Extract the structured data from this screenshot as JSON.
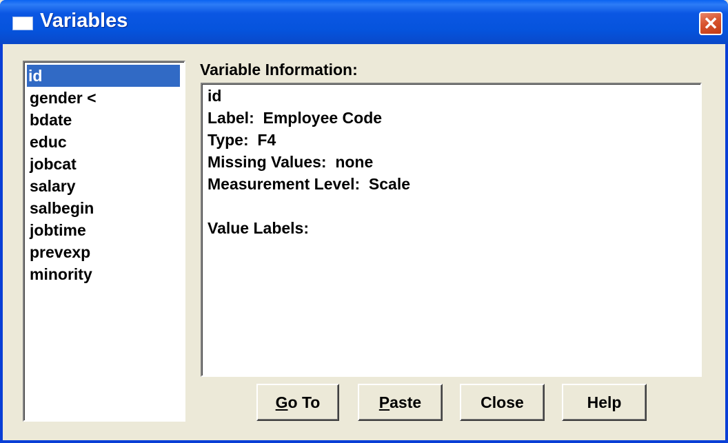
{
  "window": {
    "title": "Variables",
    "close_glyph": "✕"
  },
  "variables": {
    "items": [
      "id",
      "gender  <",
      "bdate",
      "educ",
      "jobcat",
      "salary",
      "salbegin",
      "jobtime",
      "prevexp",
      "minority"
    ],
    "selected_index": 0
  },
  "info": {
    "label": "Variable Information:",
    "lines": [
      "id",
      "Label:  Employee Code",
      "Type:  F4",
      "Missing Values:  none",
      "Measurement Level:  Scale",
      "",
      "Value Labels:"
    ]
  },
  "buttons": {
    "goto": {
      "mnemonic": "G",
      "rest": "o To"
    },
    "paste": {
      "mnemonic": "P",
      "rest": "aste"
    },
    "close": "Close",
    "help": "Help"
  },
  "colors": {
    "selection": "#316ac5",
    "titlebar": "#0553dc",
    "close_button": "#d8542e",
    "dialog_bg": "#ece9d8"
  }
}
